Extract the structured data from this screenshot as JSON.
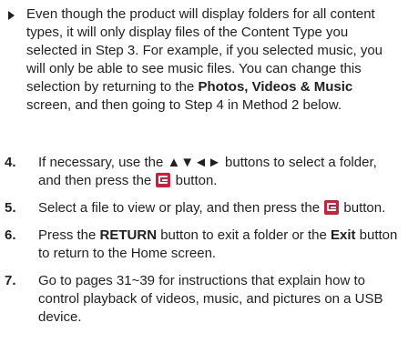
{
  "bullet": {
    "line1": "Even though the product will display folders for all content types, it will only display files of the Content Type you selected in Step 3. For example, if you selected music, you will only be able to see music files. You can change this selection by returning to the ",
    "bold1": "Photos, Videos & Music",
    "line2": " screen, and then going to Step 4 in Method 2 below."
  },
  "steps": [
    {
      "num": "4.",
      "text_before": "If necessary, use the ▲▼◄► buttons to select a folder, and then press the ",
      "text_after": " button."
    },
    {
      "num": "5.",
      "text_before": "Select a file to view or play, and then press the ",
      "text_after": " button."
    },
    {
      "num": "6.",
      "text_a": "Press the ",
      "bold_a": "RETURN",
      "text_b": " button to exit a folder or the ",
      "bold_b": "Exit",
      "text_c": " button to return to the Home screen."
    },
    {
      "num": "7.",
      "text": "Go to pages 31~39 for instructions that explain how to control playback of videos, music, and pictures on a USB device."
    }
  ],
  "icons": {
    "enter": "enter-button-icon",
    "bullet": "triangle-bullet-icon"
  },
  "colors": {
    "text": "#231f20",
    "enter_button": "#cc1f3a"
  }
}
